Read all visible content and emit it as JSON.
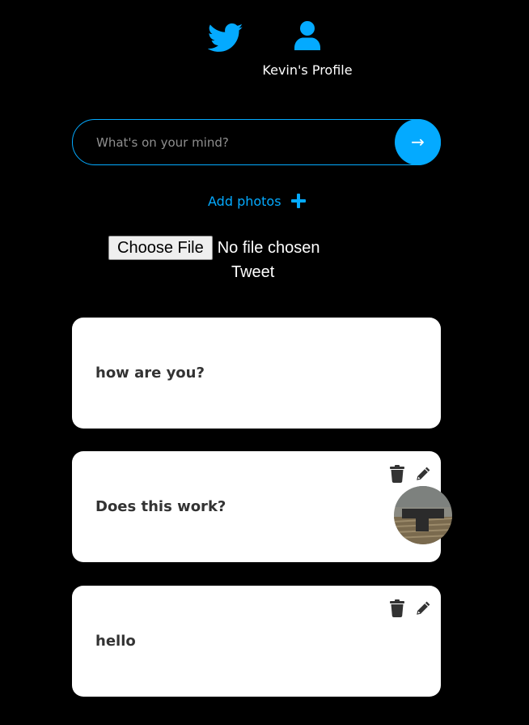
{
  "nav": {
    "home_icon": "twitter-bird-icon",
    "profile_icon": "user-icon",
    "profile_label": "Kevin's Profile"
  },
  "composer": {
    "placeholder": "What's on your mind?",
    "value": "",
    "submit_label": "→",
    "add_photos_label": "Add photos",
    "add_photos_icon": "plus-icon",
    "file_button_label": "Choose File",
    "file_status": "No file chosen",
    "tweet_label": "Tweet"
  },
  "tweets": [
    {
      "text": "how are you?",
      "has_actions": false,
      "has_photo": false
    },
    {
      "text": "Does this work?",
      "has_actions": true,
      "has_photo": true
    },
    {
      "text": "hello",
      "has_actions": true,
      "has_photo": false
    }
  ],
  "colors": {
    "accent": "#04aaff",
    "background": "#000000",
    "card": "#ffffff",
    "card_text": "#333333"
  }
}
